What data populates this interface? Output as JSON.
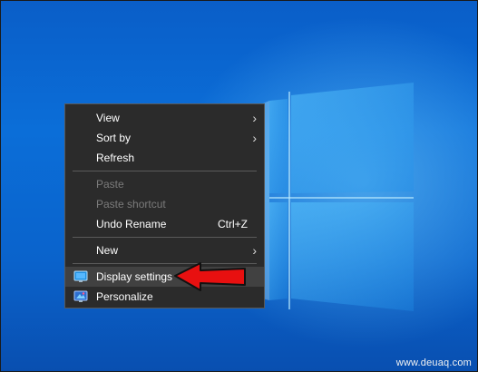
{
  "menu": {
    "items": [
      {
        "label": "View"
      },
      {
        "label": "Sort by"
      },
      {
        "label": "Refresh"
      },
      {
        "label": "Paste"
      },
      {
        "label": "Paste shortcut"
      },
      {
        "label": "Undo Rename",
        "shortcut": "Ctrl+Z"
      },
      {
        "label": "New"
      },
      {
        "label": "Display settings",
        "icon": "display-icon"
      },
      {
        "label": "Personalize",
        "icon": "personalize-icon"
      }
    ],
    "submenu_chevron": "›"
  },
  "watermark": "www.deuaq.com",
  "colors": {
    "menu_bg": "#2b2b2b",
    "menu_highlight": "#414141",
    "arrow_red": "#e81010"
  }
}
